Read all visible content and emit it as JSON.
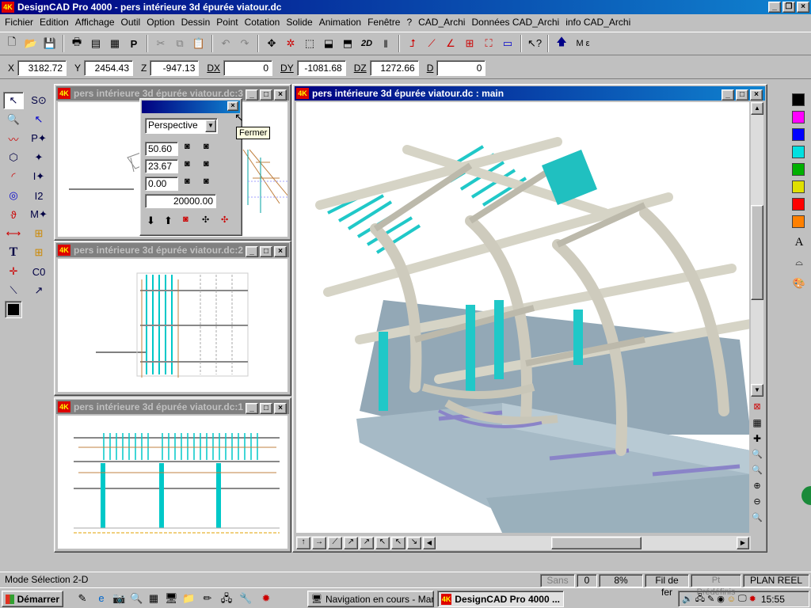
{
  "app": {
    "title": "DesignCAD Pro 4000 - pers intérieure 3d épurée viatour.dc",
    "logo": "4K"
  },
  "menu": [
    "Fichier",
    "Edition",
    "Affichage",
    "Outil",
    "Option",
    "Dessin",
    "Point",
    "Cotation",
    "Solide",
    "Animation",
    "Fenêtre",
    "?",
    "CAD_Archi",
    "Données CAD_Archi",
    "info CAD_Archi"
  ],
  "toolbar": {
    "icons": [
      "new-file-icon",
      "open-folder-icon",
      "save-icon",
      "print-icon",
      "print-preview-icon",
      "print-setup-icon",
      "text-p-icon",
      "cut-icon",
      "copy-icon",
      "paste-icon",
      "undo-icon",
      "redo-icon",
      "move-icon",
      "select-point-icon",
      "view-3d-icon",
      "view-front-icon",
      "view-side-icon",
      "view-2d-icon",
      "divider-icon",
      "snap-icon",
      "line-snap-icon",
      "angle-icon",
      "grid-icon",
      "selection-box-icon",
      "window-icon",
      "help-cursor-icon",
      "up-arrow-icon"
    ],
    "label_2d": "2D",
    "label_me": "M ε"
  },
  "coords": {
    "x_label": "X",
    "x": "3182.72",
    "y_label": "Y",
    "y": "2454.43",
    "z_label": "Z",
    "z": "-947.13",
    "dx_label": "DX",
    "dx": "0",
    "dy_label": "DY",
    "dy": "-1081.68",
    "dz_label": "DZ",
    "dz": "1272.66",
    "d_label": "D",
    "d": "0"
  },
  "windows": {
    "top_left": {
      "title": "pers intérieure 3d épurée viatour.dc:3"
    },
    "mid_left": {
      "title": "pers intérieure 3d épurée viatour.dc:2"
    },
    "bot_left": {
      "title": "pers intérieure 3d épurée viatour.dc:1"
    },
    "main": {
      "title": "pers intérieure 3d épurée viatour.dc : main"
    }
  },
  "view_dialog": {
    "mode": "Perspective",
    "v1": "50.60",
    "v2": "23.67",
    "v3": "0.00",
    "distance": "20000.00",
    "tooltip": "Fermer"
  },
  "palette_colors": [
    "#000000",
    "#ff00ff",
    "#0000ff",
    "#00e0e0",
    "#00b000",
    "#e0e000",
    "#ff0000",
    "#ff8000"
  ],
  "right_tools": [
    "A"
  ],
  "status": {
    "mode": "Mode Sélection 2-D",
    "font": "Sans",
    "value": "0",
    "zoom": "8%",
    "wireframe": "Fil de fer",
    "predefined": "Pt Prédéfinis",
    "plane": "PLAN REEL"
  },
  "taskbar": {
    "start": "Démarrer",
    "task1": "Navigation en cours - Mar...",
    "task2": "DesignCAD Pro 4000 ...",
    "clock": "15:55"
  }
}
